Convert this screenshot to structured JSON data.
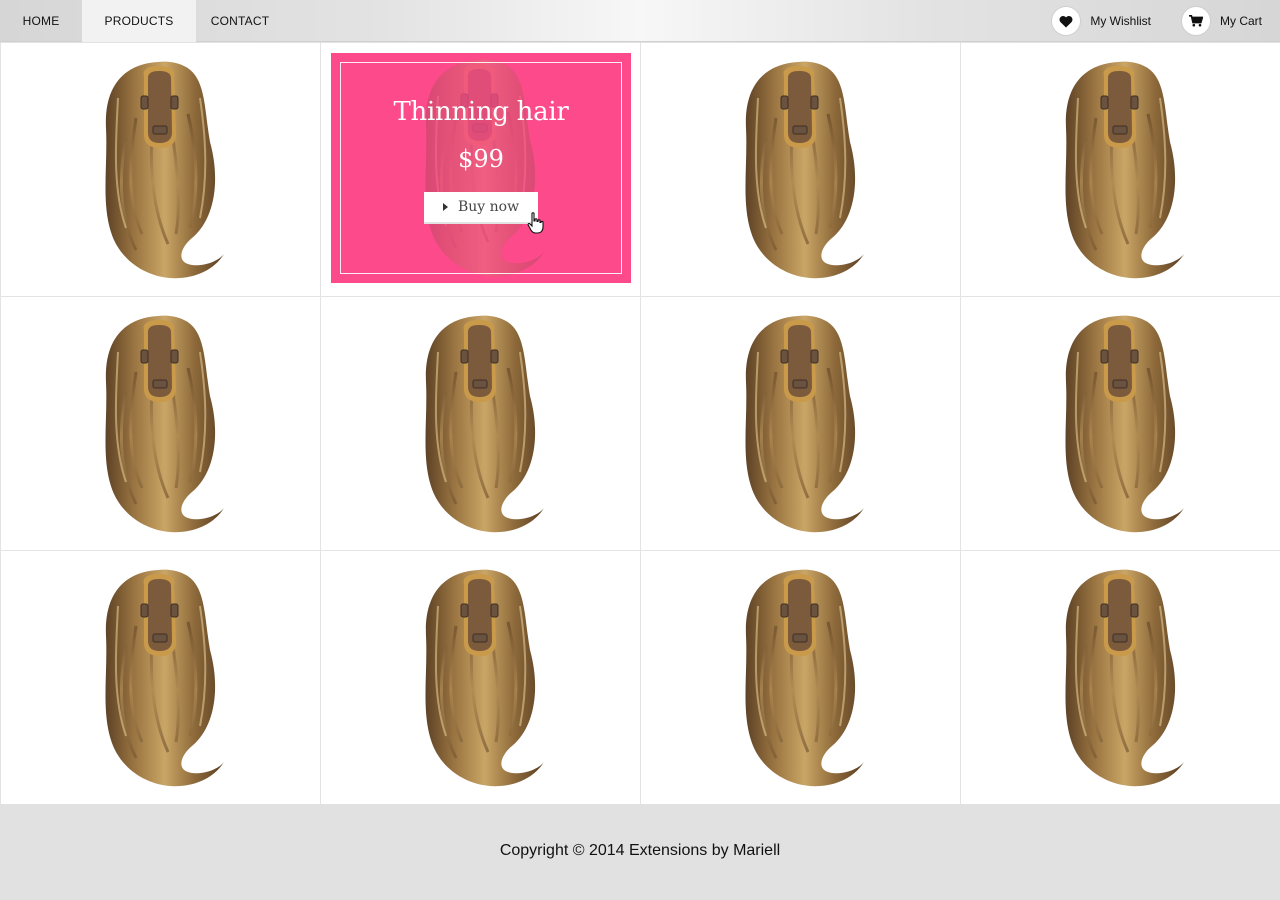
{
  "nav": {
    "items": [
      {
        "label": "HOME"
      },
      {
        "label": "PRODUCTS",
        "active": true
      },
      {
        "label": "CONTACT"
      }
    ],
    "wishlist": {
      "label": "My Wishlist",
      "icon": "heart-icon"
    },
    "cart": {
      "label": "My Cart",
      "icon": "cart-icon"
    }
  },
  "promo": {
    "title": "Thinning hair",
    "price": "$99",
    "button_label": "Buy now",
    "button_icon": "caret-right-icon",
    "cursor_icon": "hand-pointer-icon",
    "background_color": "#fc4084"
  },
  "grid": {
    "product_icon": "hair-topper-icon",
    "promo_cell_index": 1
  },
  "footer": {
    "copyright": "Copyright © 2014 Extensions by Mariell"
  }
}
